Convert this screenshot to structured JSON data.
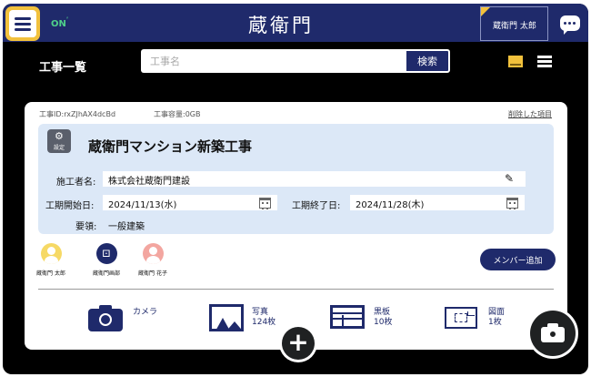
{
  "header": {
    "connection_status": "ON",
    "logo_text": "蔵衛門",
    "user_name": "蔵衛門 太郎"
  },
  "toolbar": {
    "section_title": "工事一覧",
    "search_placeholder": "工事名",
    "search_button": "検索"
  },
  "card": {
    "project_id": "工事ID:rxZJhAX4dcBd",
    "storage": "工事容量:0GB",
    "deleted_link": "削除した項目",
    "settings_label": "設定",
    "title": "蔵衛門マンション新築工事",
    "fields": {
      "builder_label": "施工者名:",
      "builder_value": "株式会社蔵衛門建設",
      "start_label": "工期開始日:",
      "start_value": "2024/11/13(水)",
      "end_label": "工期終了日:",
      "end_value": "2024/11/28(木)",
      "summary_label": "要領:",
      "summary_value": "一般建築"
    },
    "members": [
      {
        "name": "蔵衛門 太郎",
        "color": "#f6d965"
      },
      {
        "name": "蔵衛門画部",
        "logo": "ぼ"
      },
      {
        "name": "蔵衛門 花子",
        "color": "#f3a6a0"
      }
    ],
    "add_member_button": "メンバー追加",
    "tools": {
      "camera_label": "カメラ",
      "photos_label": "写真",
      "photos_count": "124枚",
      "boards_label": "黒板",
      "boards_count": "10枚",
      "drawings_label": "図面",
      "drawings_count": "1枚"
    }
  },
  "fab": {
    "add": "+"
  },
  "colors": {
    "navy": "#1f2a6b",
    "accent_yellow": "#f2c13c",
    "panel_blue": "#dce8f7",
    "on_green": "#4fd08a"
  }
}
